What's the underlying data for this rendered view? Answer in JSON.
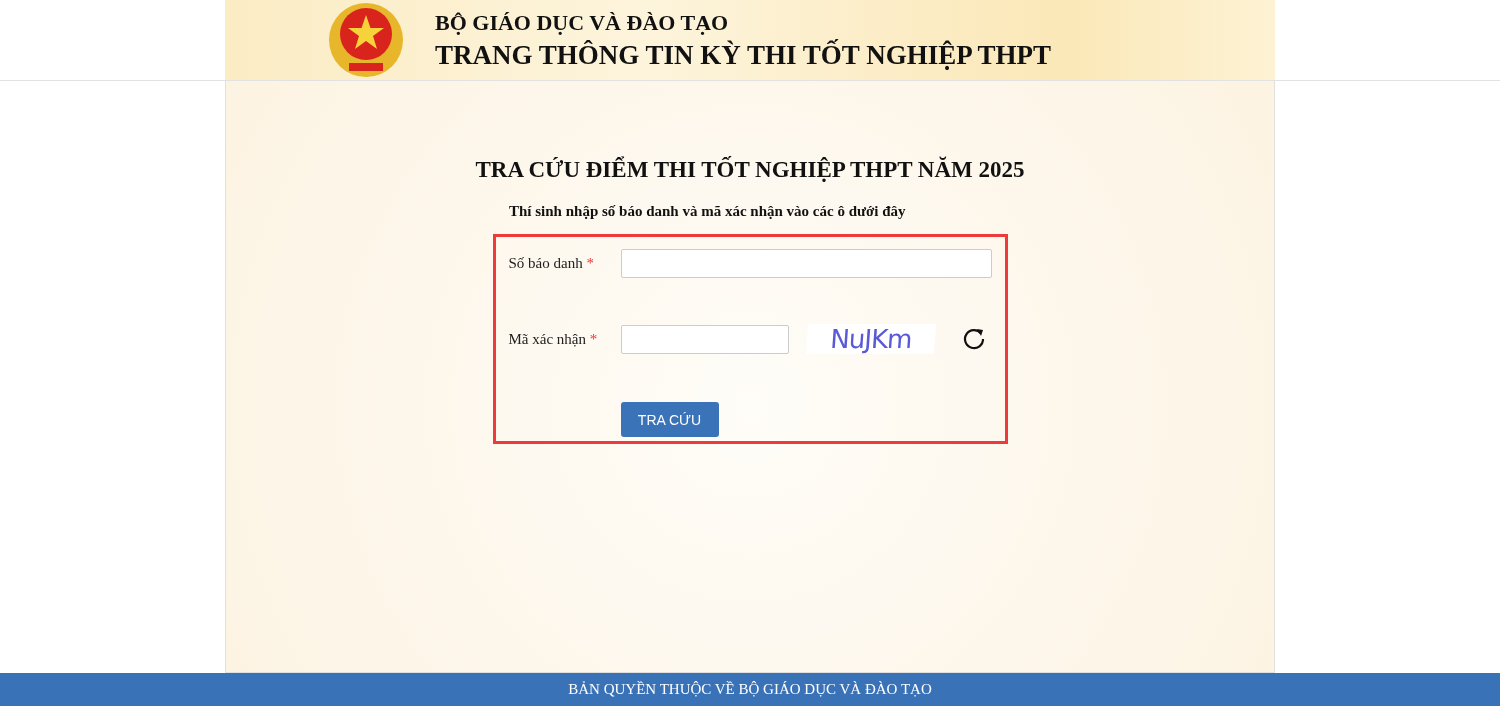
{
  "header": {
    "ministry": "BỘ GIÁO DỤC VÀ ĐÀO TẠO",
    "site_title": "TRANG THÔNG TIN KỲ THI TỐT NGHIỆP THPT"
  },
  "form": {
    "title": "TRA CỨU ĐIỂM THI TỐT NGHIỆP THPT NĂM 2025",
    "instruction": "Thí sinh nhập số báo danh và mã xác nhận vào các ô dưới đây",
    "fields": [
      {
        "kind": "text",
        "label": "Số báo danh",
        "required_mark": "*"
      },
      {
        "kind": "captcha",
        "label": "Mã xác nhận",
        "required_mark": "*",
        "captcha": "NuJKm"
      }
    ],
    "submit": "TRA CỨU"
  },
  "footer": {
    "text": "BẢN QUYỀN THUỘC VỀ BỘ GIÁO DỤC VÀ ĐÀO TẠO"
  }
}
